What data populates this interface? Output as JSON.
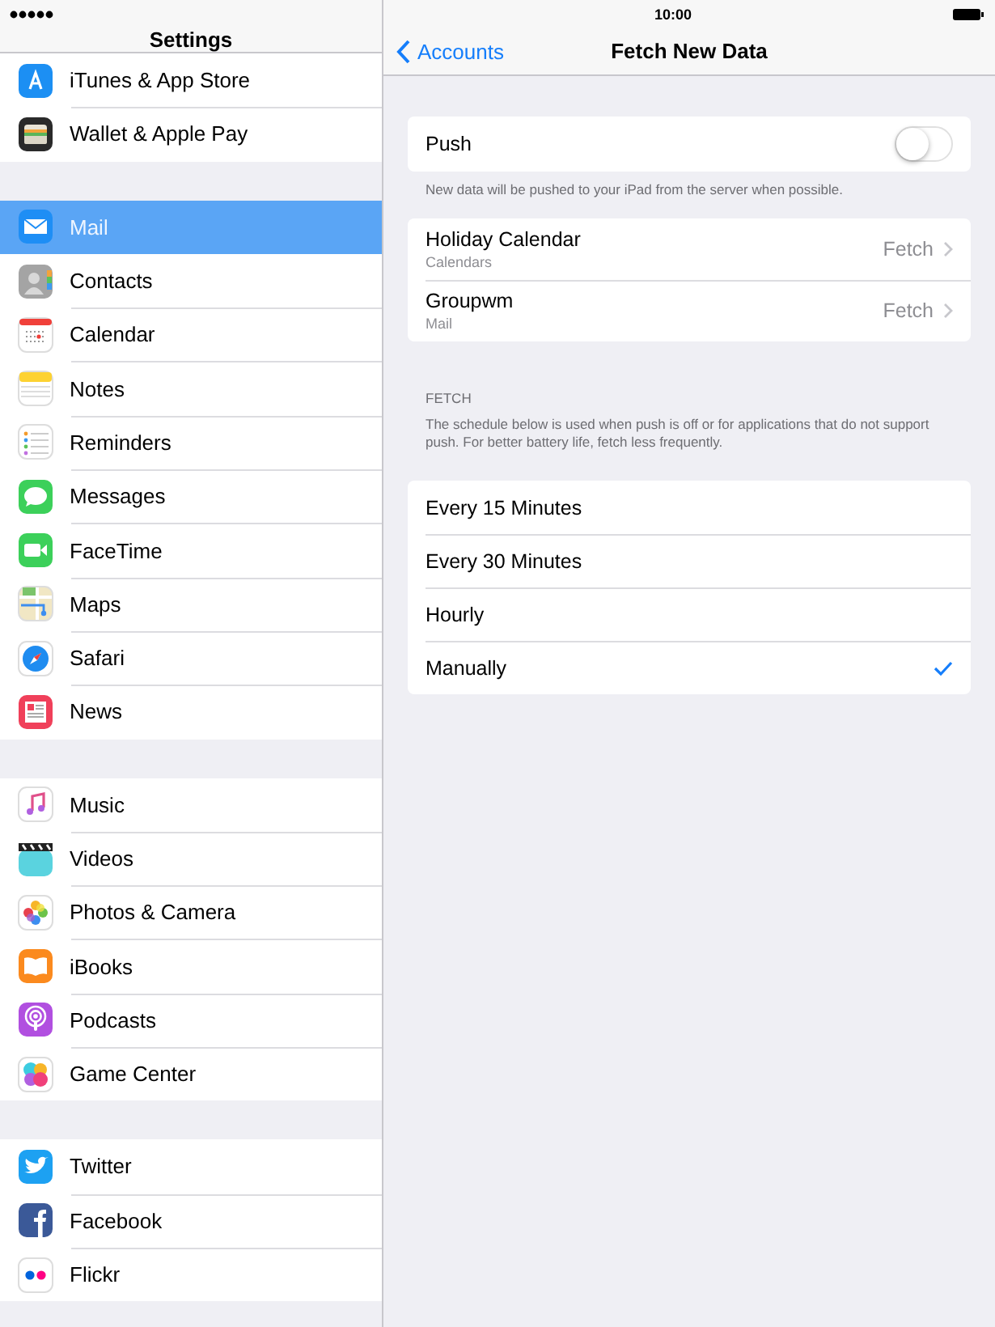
{
  "status_bar": {
    "time": "10:00"
  },
  "sidebar": {
    "title": "Settings",
    "groups": [
      {
        "items": [
          {
            "label": "iTunes & App Store",
            "selected": false
          },
          {
            "label": "Wallet & Apple Pay",
            "selected": false
          }
        ]
      },
      {
        "items": [
          {
            "label": "Mail",
            "selected": true
          },
          {
            "label": "Contacts",
            "selected": false
          },
          {
            "label": "Calendar",
            "selected": false
          },
          {
            "label": "Notes",
            "selected": false
          },
          {
            "label": "Reminders",
            "selected": false
          },
          {
            "label": "Messages",
            "selected": false
          },
          {
            "label": "FaceTime",
            "selected": false
          },
          {
            "label": "Maps",
            "selected": false
          },
          {
            "label": "Safari",
            "selected": false
          },
          {
            "label": "News",
            "selected": false
          }
        ]
      },
      {
        "items": [
          {
            "label": "Music",
            "selected": false
          },
          {
            "label": "Videos",
            "selected": false
          },
          {
            "label": "Photos & Camera",
            "selected": false
          },
          {
            "label": "iBooks",
            "selected": false
          },
          {
            "label": "Podcasts",
            "selected": false
          },
          {
            "label": "Game Center",
            "selected": false
          }
        ]
      },
      {
        "items": [
          {
            "label": "Twitter",
            "selected": false
          },
          {
            "label": "Facebook",
            "selected": false
          },
          {
            "label": "Flickr",
            "selected": false
          }
        ]
      }
    ]
  },
  "nav": {
    "back": "Accounts",
    "title": "Fetch New Data"
  },
  "push": {
    "label": "Push",
    "on": false,
    "footer": "New data will be pushed to your iPad from the server when possible."
  },
  "accounts": [
    {
      "name": "Holiday Calendar",
      "detail": "Calendars",
      "value": "Fetch"
    },
    {
      "name": "Groupwm",
      "detail": "Mail",
      "value": "Fetch"
    }
  ],
  "fetch": {
    "header": "FETCH",
    "footer": "The schedule below is used when push is off or for applications that do not support push. For better battery life, fetch less frequently.",
    "options": [
      {
        "label": "Every 15 Minutes",
        "selected": false
      },
      {
        "label": "Every 30 Minutes",
        "selected": false
      },
      {
        "label": "Hourly",
        "selected": false
      },
      {
        "label": "Manually",
        "selected": true
      }
    ]
  }
}
